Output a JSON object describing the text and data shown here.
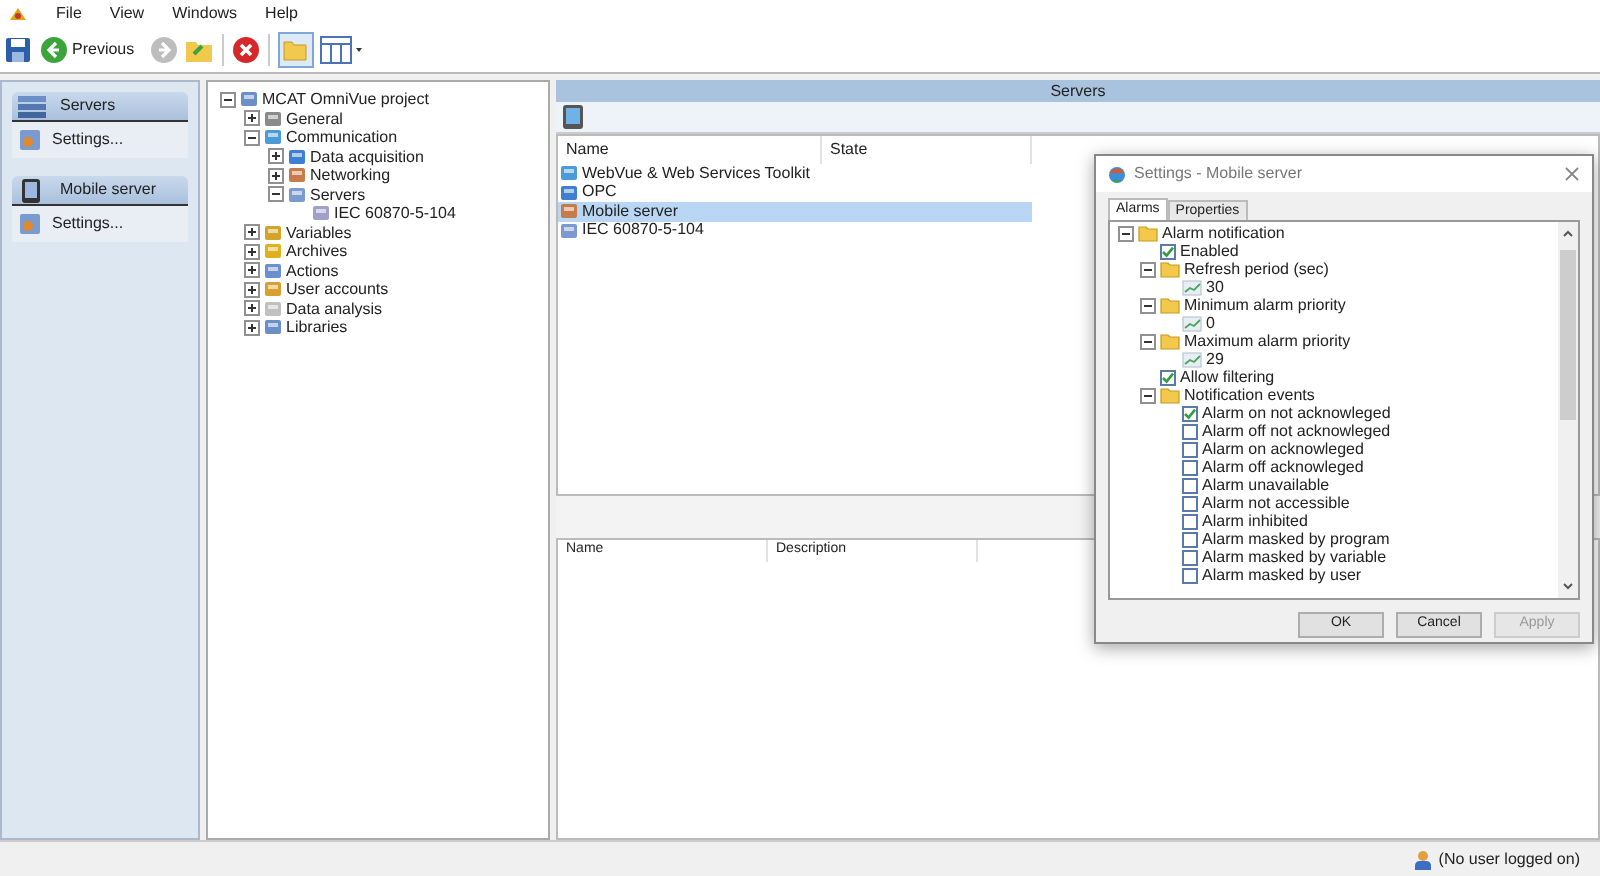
{
  "menu": [
    "File",
    "View",
    "Windows",
    "Help"
  ],
  "toolbar": {
    "previous_label": "Previous",
    "forward_disabled": true
  },
  "sidebar": {
    "groups": [
      {
        "title": "Servers",
        "items": [
          {
            "label": "Settings..."
          }
        ]
      },
      {
        "title": "Mobile server",
        "items": [
          {
            "label": "Settings..."
          }
        ]
      }
    ]
  },
  "project_tree": {
    "label": "MCAT OmniVue project",
    "expanded": true,
    "children": [
      {
        "label": "General",
        "expanded": false
      },
      {
        "label": "Communication",
        "expanded": true,
        "children": [
          {
            "label": "Data acquisition",
            "expanded": false
          },
          {
            "label": "Networking",
            "expanded": false
          },
          {
            "label": "Servers",
            "expanded": true,
            "children": [
              {
                "label": "IEC 60870-5-104"
              }
            ]
          }
        ]
      },
      {
        "label": "Variables",
        "expanded": false
      },
      {
        "label": "Archives",
        "expanded": false
      },
      {
        "label": "Actions",
        "expanded": false
      },
      {
        "label": "User accounts",
        "expanded": false
      },
      {
        "label": "Data analysis",
        "expanded": false
      },
      {
        "label": "Libraries",
        "expanded": false
      }
    ]
  },
  "servers_panel": {
    "title": "Servers",
    "columns": [
      "Name",
      "State"
    ],
    "rows": [
      {
        "name": "WebVue & Web Services Toolkit",
        "selected": false
      },
      {
        "name": "OPC",
        "selected": false
      },
      {
        "name": "Mobile server",
        "selected": true
      },
      {
        "name": "IEC 60870-5-104",
        "selected": false
      }
    ]
  },
  "details_panel": {
    "columns": [
      "Name",
      "Description"
    ]
  },
  "dialog": {
    "title": "Settings - Mobile server",
    "tabs": [
      {
        "label": "Alarms",
        "selected": true
      },
      {
        "label": "Properties",
        "selected": false
      }
    ],
    "tree": [
      {
        "kind": "folder",
        "label": "Alarm notification",
        "expanded": true,
        "children": [
          {
            "kind": "checkbox",
            "label": "Enabled",
            "checked": true
          },
          {
            "kind": "folder",
            "label": "Refresh period (sec)",
            "expanded": true,
            "children": [
              {
                "kind": "value",
                "label": "30"
              }
            ]
          },
          {
            "kind": "folder",
            "label": "Minimum alarm priority",
            "expanded": true,
            "children": [
              {
                "kind": "value",
                "label": "0"
              }
            ]
          },
          {
            "kind": "folder",
            "label": "Maximum alarm priority",
            "expanded": true,
            "children": [
              {
                "kind": "value",
                "label": "29"
              }
            ]
          },
          {
            "kind": "checkbox",
            "label": "Allow filtering",
            "checked": true
          },
          {
            "kind": "folder",
            "label": "Notification events",
            "expanded": true,
            "children": [
              {
                "kind": "checkbox",
                "label": "Alarm on not acknowleged",
                "checked": true
              },
              {
                "kind": "checkbox",
                "label": "Alarm off not acknowleged",
                "checked": false
              },
              {
                "kind": "checkbox",
                "label": "Alarm on acknowleged",
                "checked": false
              },
              {
                "kind": "checkbox",
                "label": "Alarm off acknowleged",
                "checked": false
              },
              {
                "kind": "checkbox",
                "label": "Alarm unavailable",
                "checked": false
              },
              {
                "kind": "checkbox",
                "label": "Alarm not accessible",
                "checked": false
              },
              {
                "kind": "checkbox",
                "label": "Alarm inhibited",
                "checked": false
              },
              {
                "kind": "checkbox",
                "label": "Alarm masked by program",
                "checked": false
              },
              {
                "kind": "checkbox",
                "label": "Alarm masked by variable",
                "checked": false
              },
              {
                "kind": "checkbox",
                "label": "Alarm masked by user",
                "checked": false
              }
            ]
          }
        ]
      }
    ],
    "buttons": [
      {
        "label": "OK",
        "disabled": false
      },
      {
        "label": "Cancel",
        "disabled": false
      },
      {
        "label": "Apply",
        "disabled": true
      }
    ]
  },
  "status_bar": {
    "user": "(No user logged on)"
  }
}
